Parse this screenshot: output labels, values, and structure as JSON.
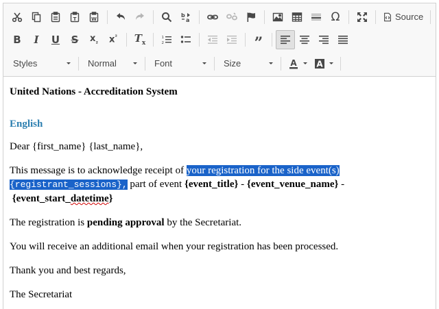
{
  "toolbar": {
    "source_label": "Source",
    "combos": {
      "styles": "Styles",
      "format": "Normal",
      "font": "Font",
      "size": "Size"
    }
  },
  "content": {
    "title": "United Nations - Accreditation System",
    "language_heading": "English",
    "greeting": "Dear {first_name} {last_name},",
    "ack_before": "This message is to acknowledge receipt of ",
    "ack_selected_1": "your registration for the side event(s)",
    "ack_selected_2": "{registrant_sessions},",
    "ack_part": " part of event ",
    "event_title": "{event_title}",
    "dash1": " - ",
    "event_venue": "{event_venue_name}",
    "dash2": " -",
    "datetime_open": "{event_start_",
    "datetime_word": "datetime",
    "datetime_close": "}",
    "pending_before": "The registration is ",
    "pending_bold": "pending approval",
    "pending_after": " by the Secretariat.",
    "additional": "You will receive an additional email when your registration has been processed.",
    "thanks": "Thank you and best regards,",
    "signature": "The Secretariat"
  }
}
